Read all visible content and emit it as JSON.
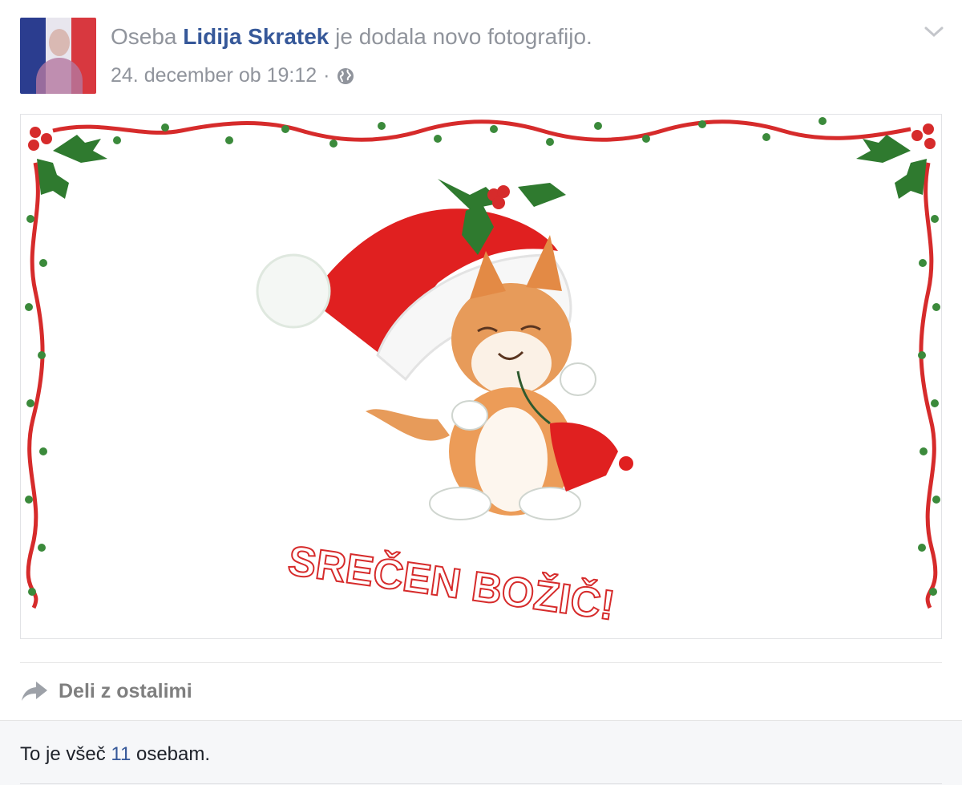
{
  "post": {
    "headline_prefix": "Oseba",
    "author": "Lidija Skratek",
    "headline_suffix": "je dodala novo fotografijo.",
    "timestamp": "24. december ob 19:12",
    "separator": "·",
    "privacy_icon": "globe-icon",
    "menu_icon": "chevron-down-icon"
  },
  "photo": {
    "greeting": "SREČEN BOŽIČ!"
  },
  "actions": {
    "share_label": "Deli z ostalimi",
    "share_icon": "share-arrow-icon"
  },
  "likes": {
    "prefix": "To je všeč",
    "count": "11",
    "suffix": "osebam."
  },
  "colors": {
    "link": "#365899",
    "meta": "#90949c",
    "holly_red": "#d62b2b",
    "holly_green": "#2f7a2f"
  }
}
